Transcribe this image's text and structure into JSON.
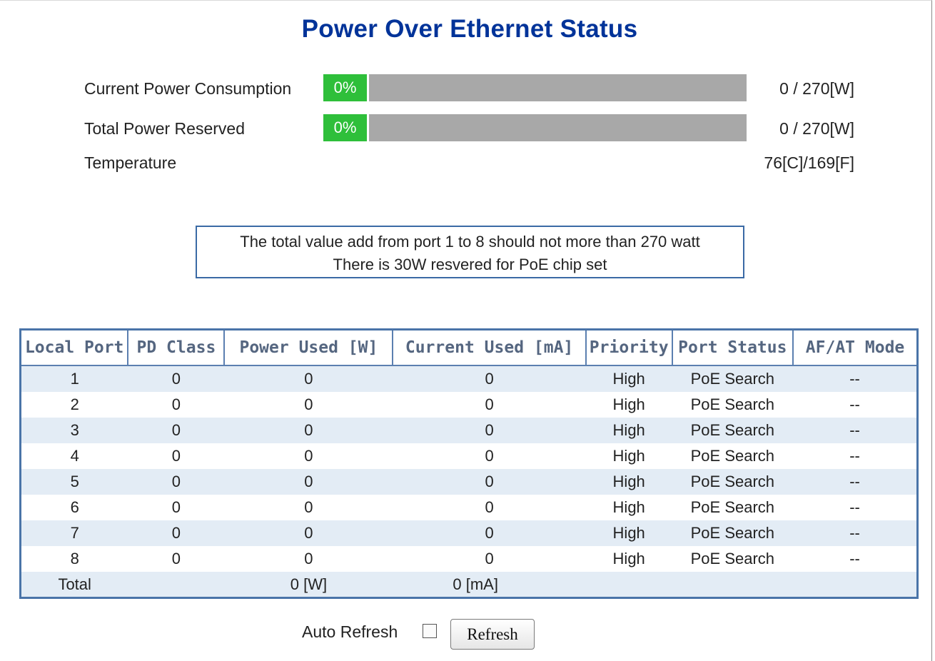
{
  "page": {
    "title": "Power Over Ethernet Status"
  },
  "power": {
    "consumption": {
      "label": "Current Power Consumption",
      "percent_text": "0%",
      "fraction": 0,
      "value": "0 / 270[W]"
    },
    "reserved": {
      "label": "Total Power Reserved",
      "percent_text": "0%",
      "fraction": 0,
      "value": "0 / 270[W]"
    },
    "temperature": {
      "label": "Temperature",
      "value": "76[C]/169[F]"
    }
  },
  "notice": {
    "line1": "The total value add from port 1 to 8 should not more than 270 watt",
    "line2": "There is 30W resvered for PoE chip set"
  },
  "table": {
    "headers": [
      "Local Port",
      "PD Class",
      "Power Used [W]",
      "Current Used [mA]",
      "Priority",
      "Port Status",
      "AF/AT Mode"
    ],
    "rows": [
      [
        "1",
        "0",
        "0",
        "0",
        "High",
        "PoE Search",
        "--"
      ],
      [
        "2",
        "0",
        "0",
        "0",
        "High",
        "PoE Search",
        "--"
      ],
      [
        "3",
        "0",
        "0",
        "0",
        "High",
        "PoE Search",
        "--"
      ],
      [
        "4",
        "0",
        "0",
        "0",
        "High",
        "PoE Search",
        "--"
      ],
      [
        "5",
        "0",
        "0",
        "0",
        "High",
        "PoE Search",
        "--"
      ],
      [
        "6",
        "0",
        "0",
        "0",
        "High",
        "PoE Search",
        "--"
      ],
      [
        "7",
        "0",
        "0",
        "0",
        "High",
        "PoE Search",
        "--"
      ],
      [
        "8",
        "0",
        "0",
        "0",
        "High",
        "PoE Search",
        "--"
      ]
    ],
    "total": {
      "label": "Total",
      "power": "0 [W]",
      "current": "0 [mA]"
    }
  },
  "controls": {
    "auto_refresh_label": "Auto Refresh",
    "auto_refresh_checked": false,
    "refresh_button": "Refresh"
  },
  "colors": {
    "title": "#003399",
    "bar_fill": "#2ebf3a",
    "bar_track": "#a8a8a8",
    "table_border": "#4a74a8",
    "row_stripe": "#e3ecf5"
  }
}
